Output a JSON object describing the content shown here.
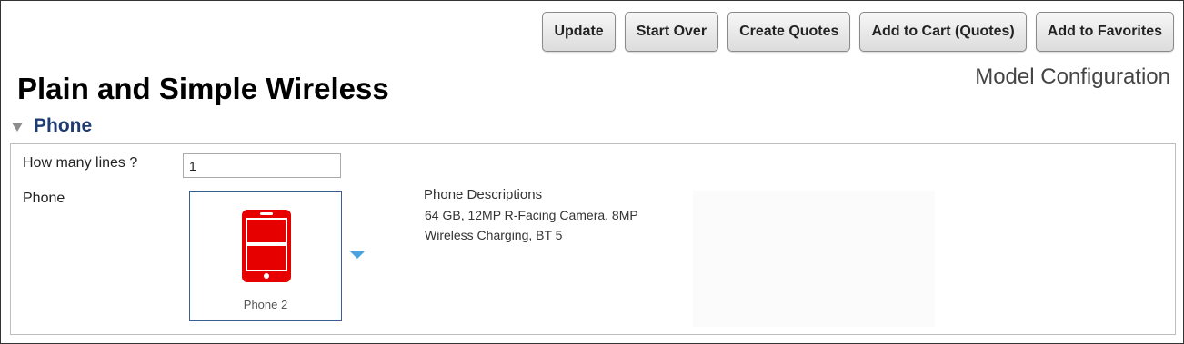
{
  "toolbar": {
    "buttons": [
      {
        "label": "Update"
      },
      {
        "label": "Start Over"
      },
      {
        "label": "Create Quotes"
      },
      {
        "label": "Add to Cart (Quotes)"
      },
      {
        "label": "Add to Favorites"
      }
    ]
  },
  "header": {
    "subtitle": "Model Configuration",
    "title": "Plain and Simple Wireless"
  },
  "section": {
    "title": "Phone"
  },
  "form": {
    "lines_label": "How many lines ?",
    "lines_value": "1",
    "phone_label": "Phone",
    "phone_option": {
      "caption": "Phone 2",
      "icon": "phone-icon",
      "color": "#e60000"
    },
    "description": {
      "title": "Phone Descriptions",
      "line1": "64 GB, 12MP R-Facing Camera, 8MP",
      "line2": "Wireless Charging, BT 5"
    }
  },
  "colors": {
    "accent": "#1f3b73",
    "dropdown": "#4aa3df",
    "phone": "#e60000"
  }
}
